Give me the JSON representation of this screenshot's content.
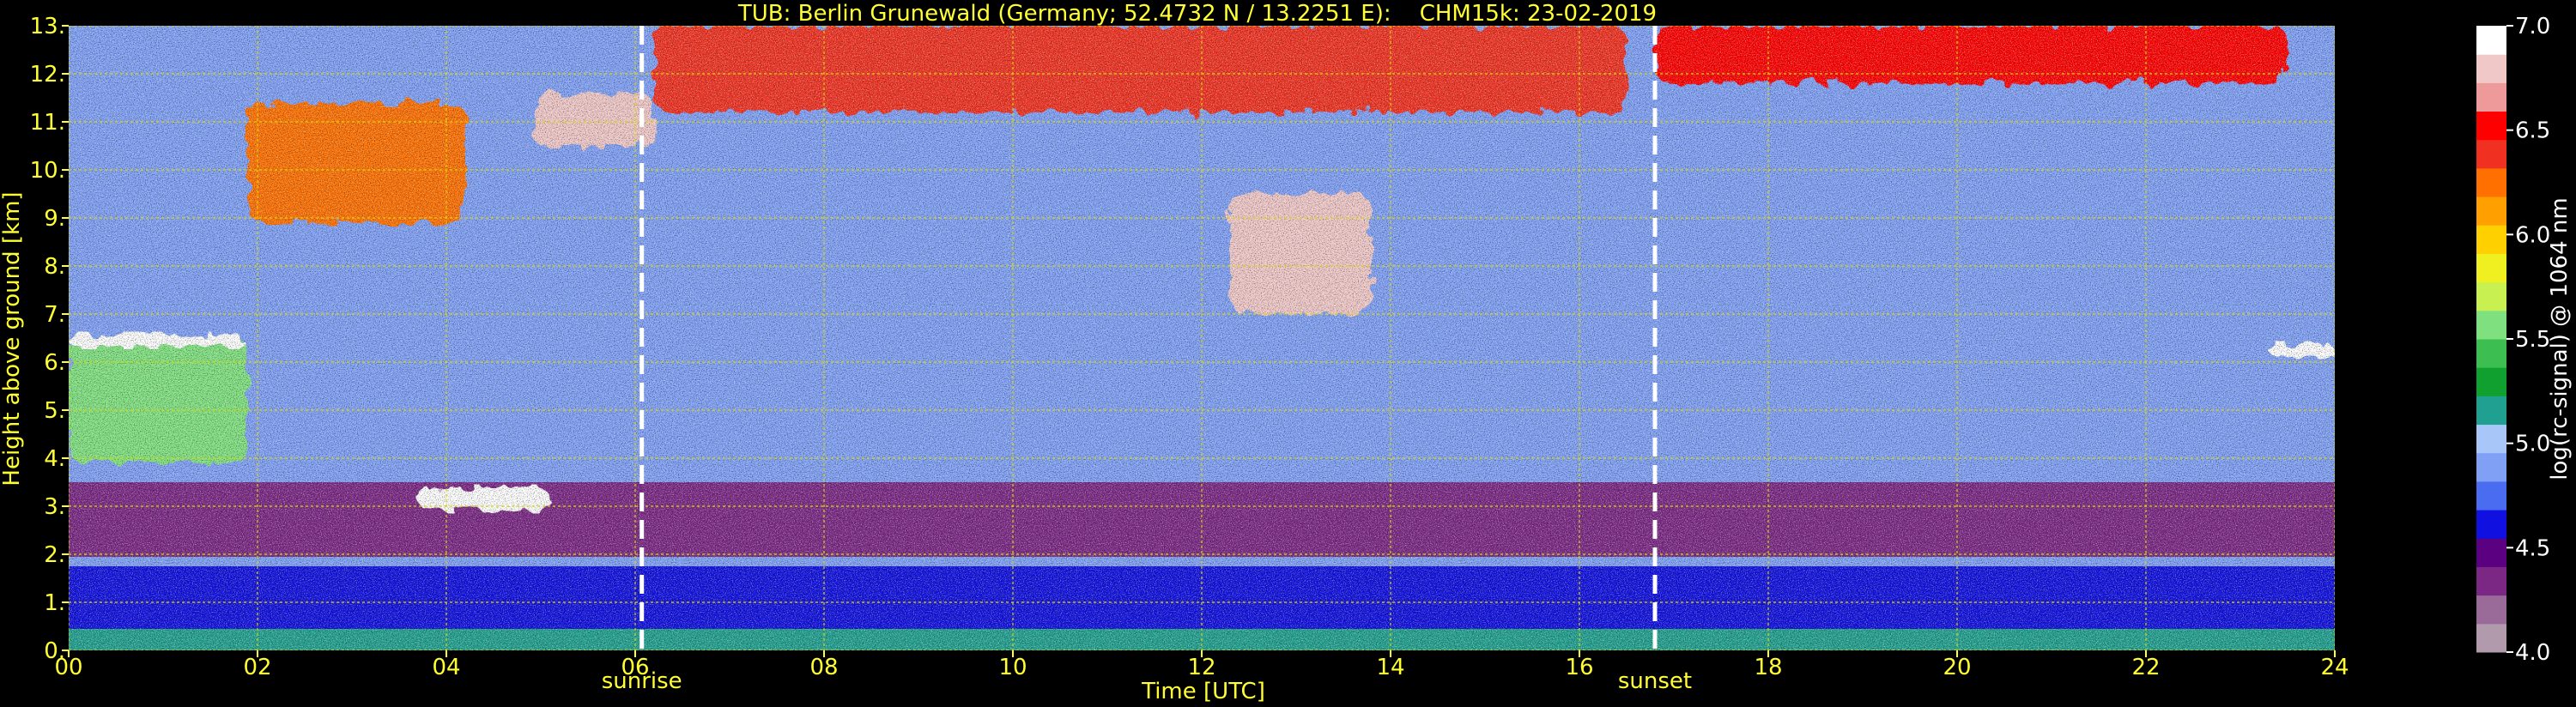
{
  "colors": {
    "text_yellow": "#ffff33",
    "text_white": "#ffffff",
    "background": "#000000",
    "grid": "#d8d800",
    "marker": "#ffffff"
  },
  "chart_data": [
    {
      "type": "heatmap",
      "title": "TUB: Berlin Grunewald (Germany; 52.4732 N / 13.2251 E):    CHM15k: 23-02-2019",
      "xlabel": "Time [UTC]",
      "ylabel": "Height above ground [km]",
      "xlim": [
        0,
        24
      ],
      "ylim": [
        0,
        13
      ],
      "xticks": [
        0,
        2,
        4,
        6,
        8,
        10,
        12,
        14,
        16,
        18,
        20,
        22,
        24
      ],
      "xtick_labels": [
        "00",
        "02",
        "04",
        "06",
        "08",
        "10",
        "12",
        "14",
        "16",
        "18",
        "20",
        "22",
        "24"
      ],
      "yticks": [
        0,
        1,
        2,
        3,
        4,
        5,
        6,
        7,
        8,
        9,
        10,
        11,
        12,
        13
      ],
      "ytick_labels": [
        "0.",
        "1.",
        "2.",
        "3.",
        "4.",
        "5.",
        "6.",
        "7.",
        "8.",
        "9.",
        "10.",
        "11.",
        "12.",
        "13."
      ],
      "grid": true,
      "annotations": [
        {
          "text": "sunrise",
          "x": 6.07
        },
        {
          "text": "sunset",
          "x": 16.8
        }
      ],
      "layers": [
        {
          "kind": "surface",
          "t0": 0,
          "t1": 24,
          "h0": 0.0,
          "h1": 0.45,
          "value": 5.1
        },
        {
          "kind": "band",
          "t0": 0,
          "t1": 24,
          "h0": 0.45,
          "h1": 1.05,
          "value": 4.65
        },
        {
          "kind": "band",
          "t0": 0,
          "t1": 24,
          "h0": 1.05,
          "h1": 1.75,
          "value": 4.55
        },
        {
          "kind": "band",
          "t0": 0,
          "t1": 24,
          "h0": 1.75,
          "h1": 1.95,
          "value": 4.9
        },
        {
          "kind": "band",
          "t0": 0,
          "t1": 24,
          "h0": 1.95,
          "h1": 3.5,
          "value": 4.4
        },
        {
          "kind": "band",
          "t0": 0,
          "t1": 24,
          "h0": 3.5,
          "h1": 9.0,
          "value": 4.95
        },
        {
          "kind": "band",
          "t0": 0,
          "t1": 24,
          "h0": 9.0,
          "h1": 13.0,
          "value": 4.85
        },
        {
          "kind": "cloud",
          "t0": 0.0,
          "t1": 1.9,
          "h0": 3.9,
          "h1": 6.5,
          "value": 5.6
        },
        {
          "kind": "cloud",
          "t0": 0.0,
          "t1": 1.85,
          "h0": 6.3,
          "h1": 6.6,
          "value": 7.0
        },
        {
          "kind": "cloud",
          "t0": 1.9,
          "t1": 4.2,
          "h0": 8.9,
          "h1": 11.4,
          "value": 6.3
        },
        {
          "kind": "cloud",
          "t0": 3.7,
          "t1": 5.1,
          "h0": 2.9,
          "h1": 3.4,
          "value": 7.0
        },
        {
          "kind": "cloud",
          "t0": 4.9,
          "t1": 6.2,
          "h0": 10.5,
          "h1": 11.6,
          "value": 6.8
        },
        {
          "kind": "cloud",
          "t0": 6.2,
          "t1": 16.5,
          "h0": 11.2,
          "h1": 13.0,
          "value": 6.4
        },
        {
          "kind": "cloud",
          "t0": 12.3,
          "t1": 13.8,
          "h0": 7.0,
          "h1": 9.5,
          "value": 6.8
        },
        {
          "kind": "cloud",
          "t0": 16.8,
          "t1": 23.5,
          "h0": 11.8,
          "h1": 13.0,
          "value": 6.5
        },
        {
          "kind": "cloud",
          "t0": 23.3,
          "t1": 24.0,
          "h0": 6.1,
          "h1": 6.4,
          "value": 7.0
        }
      ]
    },
    {
      "type": "colorbar",
      "label": "log(rc-signal) @ 1064 nm",
      "range": [
        4.0,
        7.0
      ],
      "ticks": [
        4.0,
        4.5,
        5.0,
        5.5,
        6.0,
        6.5,
        7.0
      ],
      "tick_labels": [
        "4.0",
        "4.5",
        "5.0",
        "5.5",
        "6.0",
        "6.5",
        "7.0"
      ],
      "colors": [
        "#b09aac",
        "#9a6a98",
        "#7a2884",
        "#5a0080",
        "#1010e0",
        "#4a6cf0",
        "#7fa0f5",
        "#a8c6f8",
        "#20a090",
        "#10a030",
        "#3cbf50",
        "#7fe07f",
        "#c8f050",
        "#f0f020",
        "#ffd000",
        "#ffa000",
        "#ff7000",
        "#f03020",
        "#ff0000",
        "#ee9a9a",
        "#f0c8c8",
        "#ffffff"
      ]
    }
  ]
}
